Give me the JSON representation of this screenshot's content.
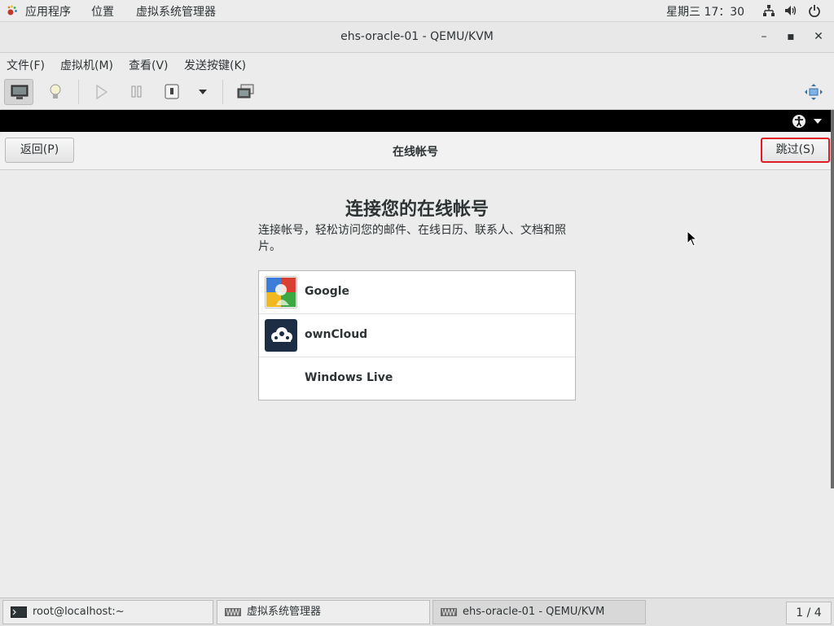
{
  "top_panel": {
    "apps_menu": "应用程序",
    "places_menu": "位置",
    "vm_manager_menu": "虚拟系统管理器",
    "clock": "星期三 17：30"
  },
  "window": {
    "title": "ehs-oracle-01 - QEMU/KVM",
    "minimize": "–",
    "maximize": "▪",
    "close": "✕"
  },
  "menubar": {
    "items": [
      "文件(F)",
      "虚拟机(M)",
      "查看(V)",
      "发送按键(K)"
    ]
  },
  "guest": {
    "back_button": "返回(P)",
    "page_title": "在线帐号",
    "skip_button": "跳过(S)",
    "heading": "连接您的在线帐号",
    "description": "连接帐号，轻松访问您的邮件、在线日历、联系人、文档和照片。",
    "providers": [
      {
        "name": "Google",
        "icon": "google-icon"
      },
      {
        "name": "ownCloud",
        "icon": "owncloud-icon"
      },
      {
        "name": "Windows Live",
        "icon": ""
      }
    ]
  },
  "taskbar": {
    "tasks": [
      {
        "label": "root@localhost:~",
        "icon": "terminal-icon"
      },
      {
        "label": "虚拟系统管理器",
        "icon": "virt-manager-icon"
      },
      {
        "label": "ehs-oracle-01 - QEMU/KVM",
        "icon": "virt-manager-icon"
      }
    ],
    "workspace": "1 / 4"
  },
  "colors": {
    "skip_highlight": "#e01b24",
    "guest_bar": "#000000"
  }
}
